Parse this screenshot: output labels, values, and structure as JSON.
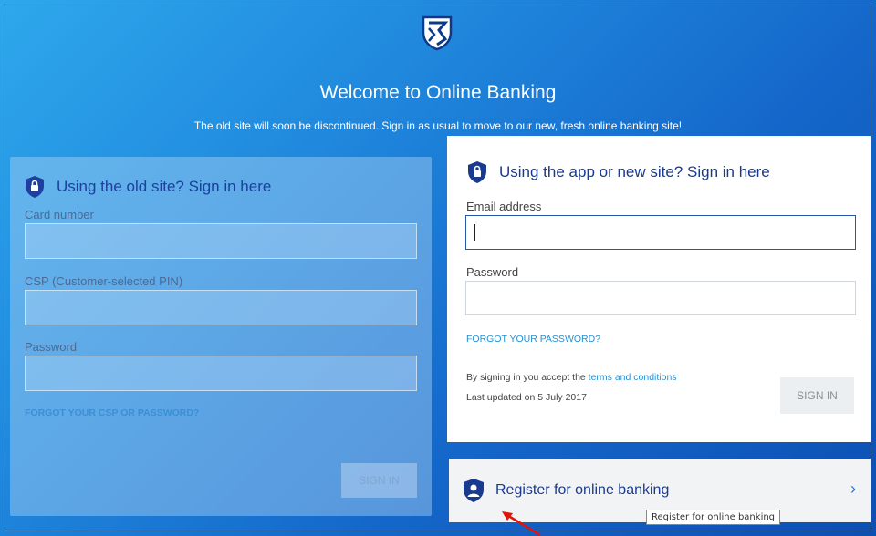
{
  "header": {
    "title": "Welcome to Online Banking",
    "subtitle": "The old site will soon be discontinued. Sign in as usual to move to our new, fresh online banking site!"
  },
  "old_site": {
    "heading": "Using the old site? Sign in here",
    "card_label": "Card number",
    "csp_label": "CSP (Customer-selected PIN)",
    "password_label": "Password",
    "forgot_link": "FORGOT YOUR CSP OR PASSWORD?",
    "signin_label": "SIGN IN"
  },
  "new_site": {
    "heading": "Using the app or new site? Sign in here",
    "email_label": "Email address",
    "password_label": "Password",
    "forgot_link": "FORGOT YOUR PASSWORD?",
    "terms_prefix": "By signing in you accept the",
    "terms_link": "terms and conditions",
    "updated": "Last updated on 5 July 2017",
    "signin_label": "SIGN IN"
  },
  "register": {
    "label": "Register for online banking",
    "tooltip": "Register for online banking"
  },
  "icons": {
    "logo": "bank-shield-logo",
    "lock": "shield-lock-icon",
    "register": "shield-user-icon",
    "chevron": "chevron-right-icon"
  },
  "colors": {
    "accent": "#1a3a8f",
    "link": "#2a8fd0",
    "background": "#1466c9"
  }
}
